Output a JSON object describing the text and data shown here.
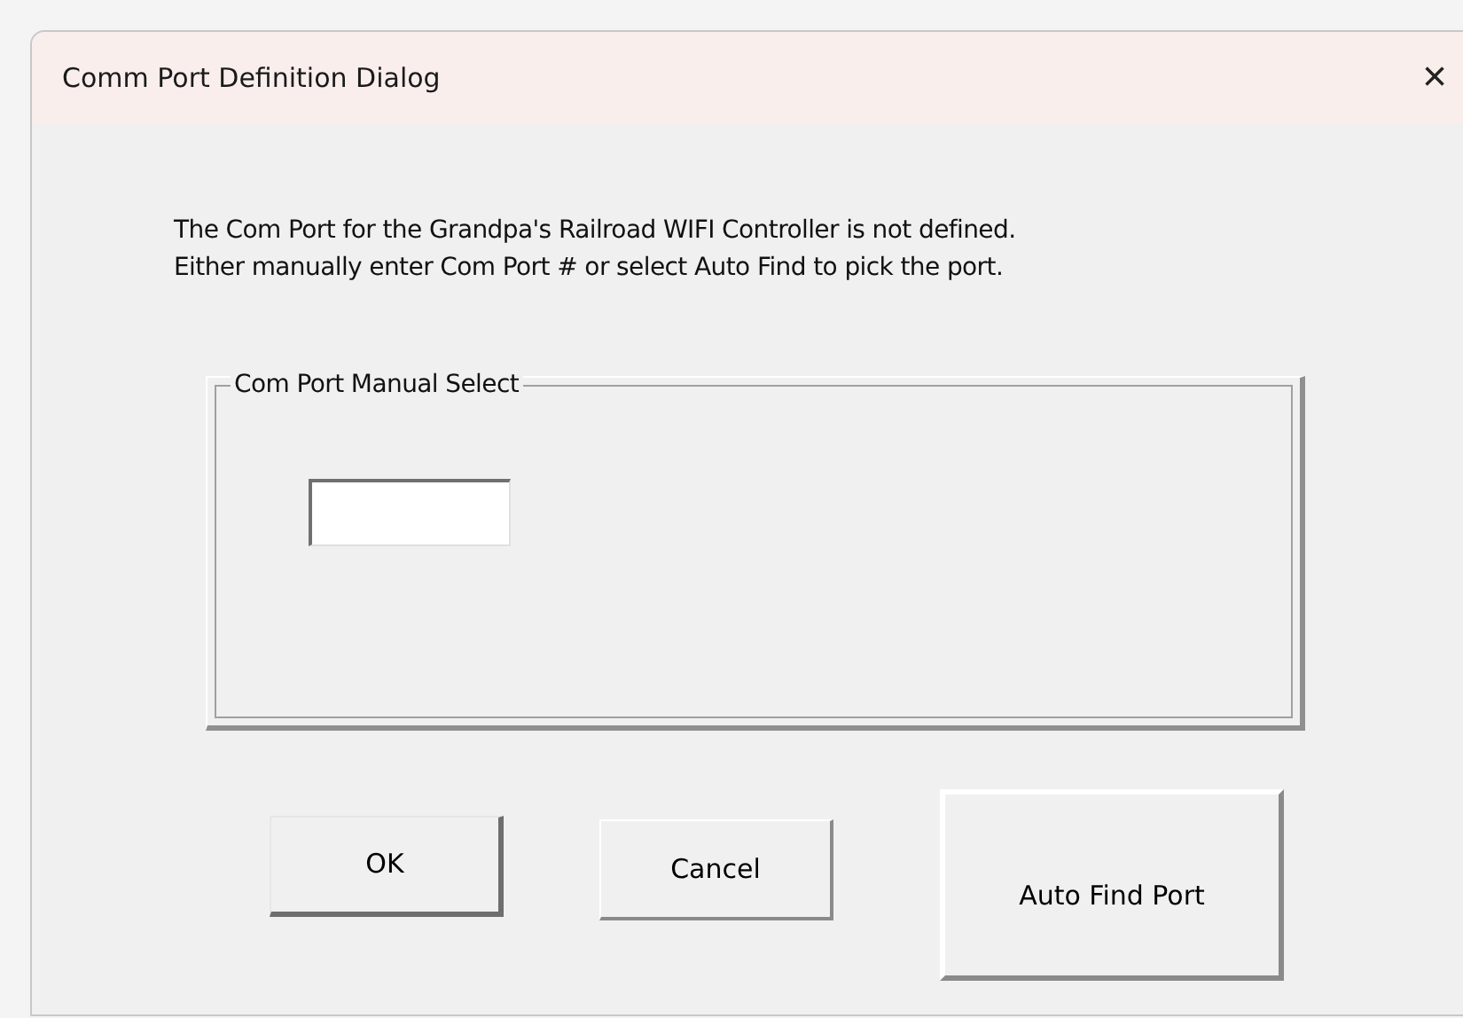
{
  "window": {
    "title": "Comm Port Definition Dialog",
    "close": "×"
  },
  "message": [
    "The Com Port for the Grandpa's Railroad WIFI Controller is not defined.",
    "Either manually enter Com Port # or select Auto Find to pick the port."
  ],
  "group": {
    "label": "Com Port Manual Select"
  },
  "buttons": [
    {
      "label": "OK",
      "kind": "ok"
    },
    {
      "label": "Cancel",
      "kind": "normal"
    },
    {
      "label": "Auto Find Port",
      "kind": "large"
    }
  ]
}
